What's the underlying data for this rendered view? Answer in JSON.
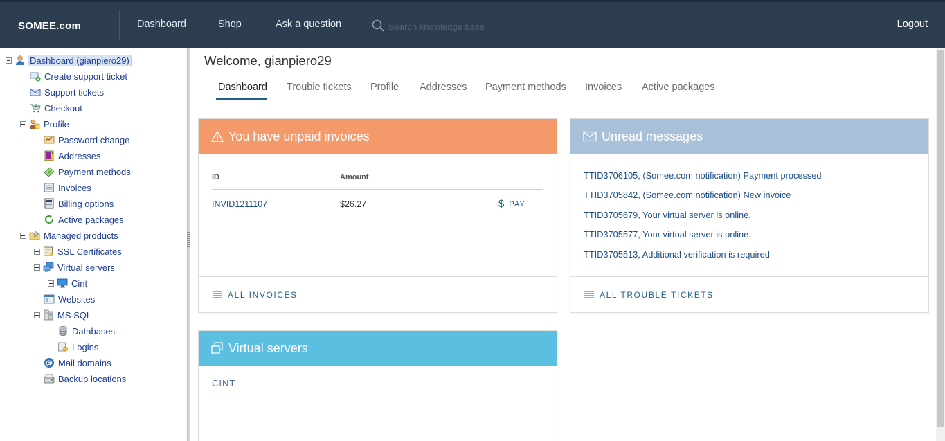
{
  "header": {
    "brand": "SOMEE.com",
    "nav": [
      "Dashboard",
      "Shop",
      "Ask a question"
    ],
    "search_placeholder": "Search knowledge base",
    "logout": "Logout"
  },
  "sidebar": {
    "items": [
      {
        "label": "Dashboard (gianpiero29)",
        "icon": "user-icon"
      },
      {
        "label": "Create support ticket",
        "icon": "create-ticket-icon"
      },
      {
        "label": "Support tickets",
        "icon": "envelope-icon"
      },
      {
        "label": "Checkout",
        "icon": "cart-icon"
      },
      {
        "label": "Profile",
        "icon": "profile-icon"
      },
      {
        "label": "Password change",
        "icon": "password-icon"
      },
      {
        "label": "Addresses",
        "icon": "address-book-icon"
      },
      {
        "label": "Payment methods",
        "icon": "money-icon"
      },
      {
        "label": "Invoices",
        "icon": "invoice-icon"
      },
      {
        "label": "Billing options",
        "icon": "billing-icon"
      },
      {
        "label": "Active packages",
        "icon": "refresh-icon"
      },
      {
        "label": "Managed products",
        "icon": "folder-icon"
      },
      {
        "label": "SSL Certificates",
        "icon": "certificate-icon"
      },
      {
        "label": "Virtual servers",
        "icon": "servers-icon"
      },
      {
        "label": "Cint",
        "icon": "monitor-icon"
      },
      {
        "label": "Websites",
        "icon": "website-icon"
      },
      {
        "label": "MS SQL",
        "icon": "sql-server-icon"
      },
      {
        "label": "Databases",
        "icon": "database-icon"
      },
      {
        "label": "Logins",
        "icon": "login-icon"
      },
      {
        "label": "Mail domains",
        "icon": "at-sign-icon"
      },
      {
        "label": "Backup locations",
        "icon": "backup-icon"
      }
    ]
  },
  "main": {
    "welcome": "Welcome, gianpiero29",
    "tabs": [
      "Dashboard",
      "Trouble tickets",
      "Profile",
      "Addresses",
      "Payment methods",
      "Invoices",
      "Active packages"
    ],
    "invoices_card": {
      "title": "You have unpaid invoices",
      "columns": [
        "ID",
        "Amount"
      ],
      "rows": [
        {
          "id": "INVID1211107",
          "amount": "$26.27",
          "action": "PAY"
        }
      ],
      "footer": "ALL INVOICES"
    },
    "messages_card": {
      "title": "Unread messages",
      "messages": [
        "TTID3706105, (Somee.com notification) Payment processed",
        "TTID3705842, (Somee.com notification) New invoice",
        "TTID3705679, Your virtual server is online.",
        "TTID3705577, Your virtual server is online.",
        "TTID3705513, Additional verification is required"
      ],
      "footer": "ALL TROUBLE TICKETS"
    },
    "servers_card": {
      "title": "Virtual servers",
      "servers": [
        "CINT"
      ]
    }
  },
  "colors": {
    "header_bg": "#2c3e50",
    "invoices_head": "#f4996a",
    "messages_head": "#a9c1d8",
    "servers_head": "#5bbfe2",
    "link": "#1d5f8b"
  }
}
